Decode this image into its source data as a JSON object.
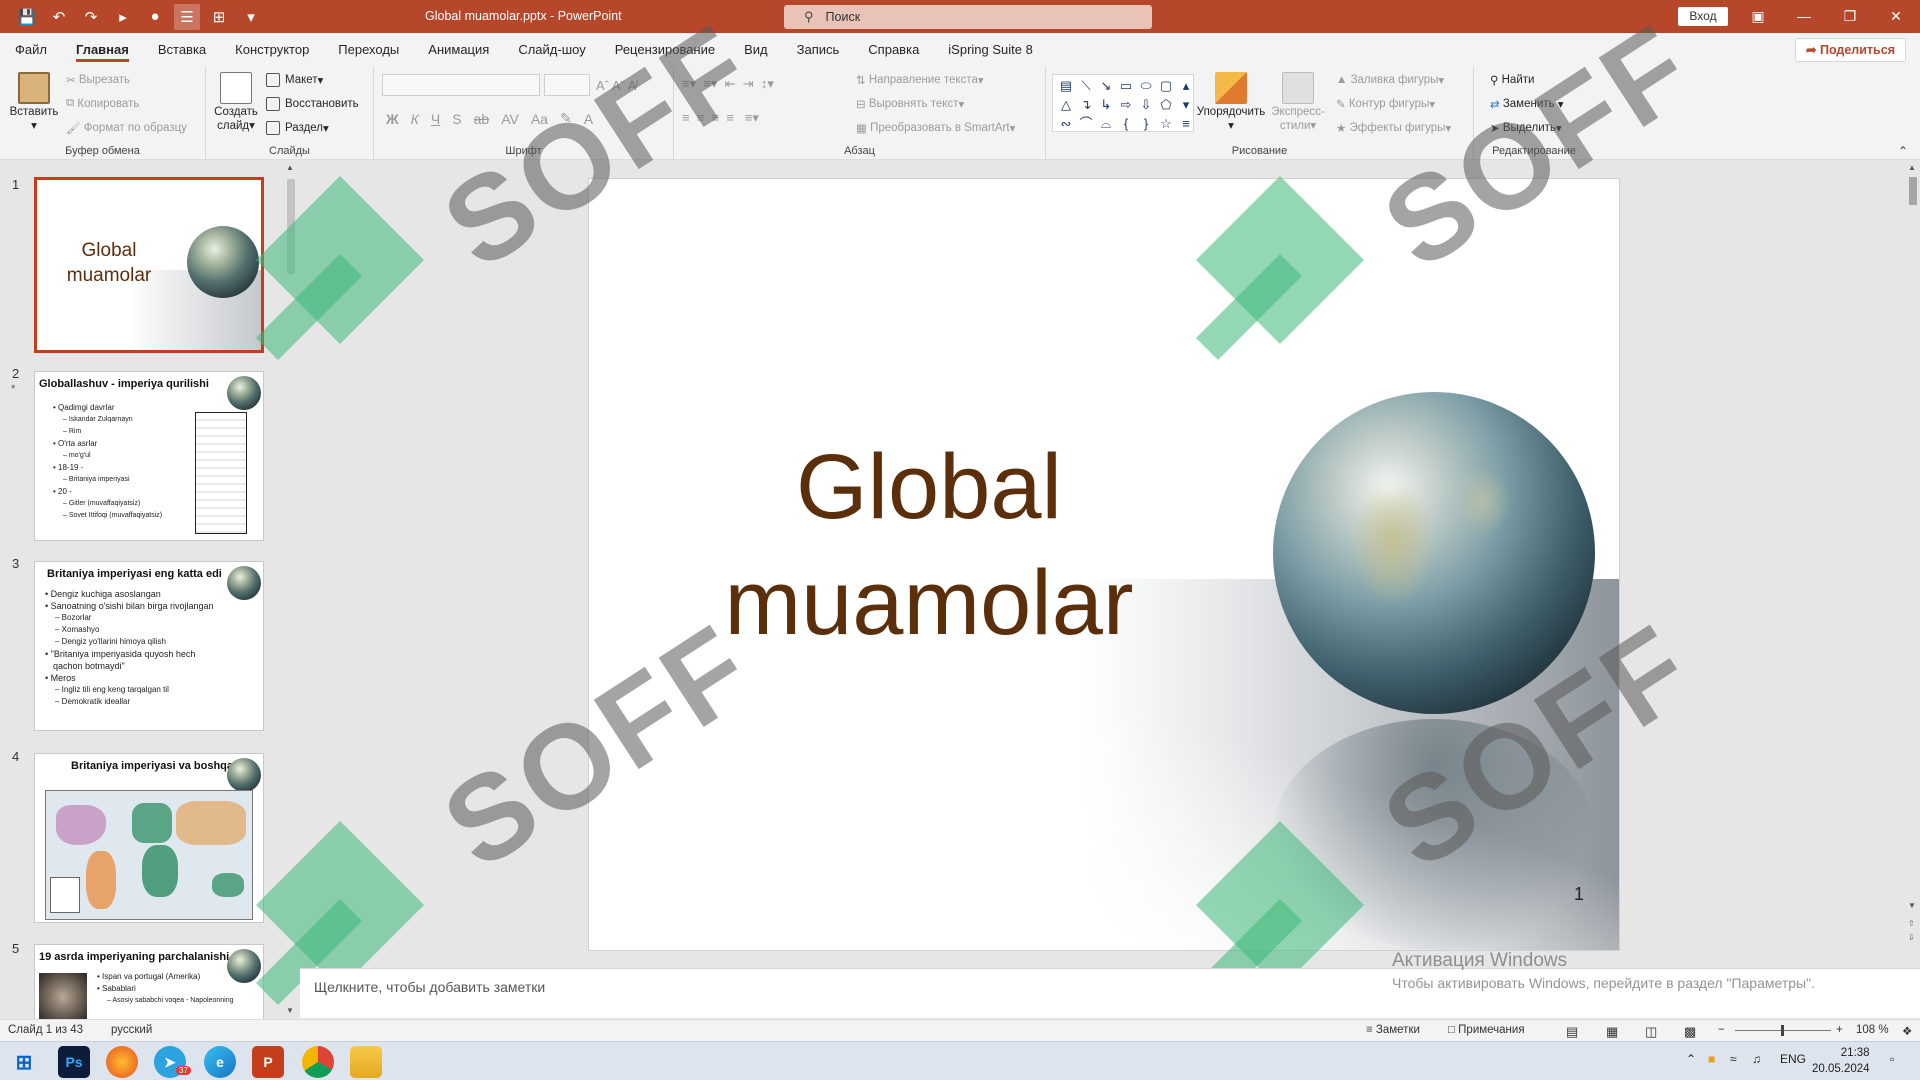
{
  "titlebar": {
    "doc_title": "Global muamolar.pptx  -  PowerPoint",
    "search_placeholder": "Поиск",
    "signin": "Вход"
  },
  "tabs": [
    "Файл",
    "Главная",
    "Вставка",
    "Конструктор",
    "Переходы",
    "Анимация",
    "Слайд-шоу",
    "Рецензирование",
    "Вид",
    "Запись",
    "Справка",
    "iSpring Suite 8"
  ],
  "active_tab": "Главная",
  "share": "Поделиться",
  "ribbon": {
    "clipboard": {
      "paste": "Вставить",
      "cut": "Вырезать",
      "copy": "Копировать",
      "format_painter": "Формат по образцу",
      "label": "Буфер обмена"
    },
    "slides": {
      "new_slide_1": "Создать",
      "new_slide_2": "слайд",
      "layout": "Макет",
      "reset": "Восстановить",
      "section": "Раздел",
      "label": "Слайды"
    },
    "font": {
      "bold": "Ж",
      "italic": "К",
      "underline": "Ч",
      "shadow": "S",
      "strike": "ab",
      "spacing": "AV",
      "case": "Aa",
      "label": "Шрифт"
    },
    "paragraph": {
      "text_direction": "Направление текста",
      "align_text": "Выровнять текст",
      "smartart": "Преобразовать в SmartArt",
      "label": "Абзац"
    },
    "drawing": {
      "arrange": "Упорядочить",
      "quick_styles_1": "Экспресс-",
      "quick_styles_2": "стили",
      "shape_fill": "Заливка фигуры",
      "shape_outline": "Контур фигуры",
      "shape_effects": "Эффекты фигуры",
      "label": "Рисование"
    },
    "editing": {
      "find": "Найти",
      "replace": "Заменить",
      "select": "Выделить",
      "label": "Редактирование"
    }
  },
  "thumbnails": [
    {
      "num": "1",
      "title": "Global muamolar"
    },
    {
      "num": "2",
      "title": "Globallashuv - imperiya qurilishi",
      "lines": [
        "•  Qadimgi davrlar",
        "– Iskandar Zulqarnayn",
        "– Rim",
        "•  O'rta asrlar",
        "– mo'g'ul",
        "•  18-19 - ",
        "– Britaniya imperiyasi",
        "•  20 - ",
        "– Gitler (muvaffaqiyatsiz)",
        "– Sovet Ittifoqi (muvaffaqiyatsiz)"
      ]
    },
    {
      "num": "3",
      "title": "Britaniya imperiyasi eng katta edi",
      "lines": [
        "•  Dengiz kuchiga asoslangan",
        "•  Sanoatning o'sishi bilan birga rivojlangan",
        "– Bozorlar",
        "– Xomashyo",
        "– Dengiz yo'llarini himoya qilish",
        "•  \"Britaniya imperiyasida quyosh hech",
        "qachon botmaydi\"",
        "•  Meros",
        "– Ingliz tili eng keng tarqalgan til",
        "– Demokratik ideallar"
      ]
    },
    {
      "num": "4",
      "title": "Britaniya imperiyasi va boshqalar"
    },
    {
      "num": "5",
      "title": "19   asrda imperiyaning parchalanishi",
      "lines": [
        "•  Ispan va portugal (Amerika)",
        "•  Sabablari",
        "– Asosiy sababchi voqea - Napoleonning"
      ]
    }
  ],
  "slide": {
    "title_line1": "Global",
    "title_line2": "muamolar",
    "number": "1"
  },
  "watermark_text": "SOFF",
  "notes_placeholder": "Щелкните, чтобы добавить заметки",
  "activation": {
    "line1": "Активация Windows",
    "line2": "Чтобы активировать Windows, перейдите в раздел \"Параметры\"."
  },
  "status": {
    "slide_of": "Слайд 1 из 43",
    "language": "русский",
    "notes": "Заметки",
    "comments": "Примечания",
    "zoom": "108 %"
  },
  "taskbar": {
    "lang": "ENG",
    "time": "21:38",
    "date": "20.05.2024",
    "telegram_badge": "37"
  },
  "colors": {
    "accent": "#b7472a",
    "slide_title": "#5b2e0c",
    "watermark_green": "#3cb878"
  }
}
